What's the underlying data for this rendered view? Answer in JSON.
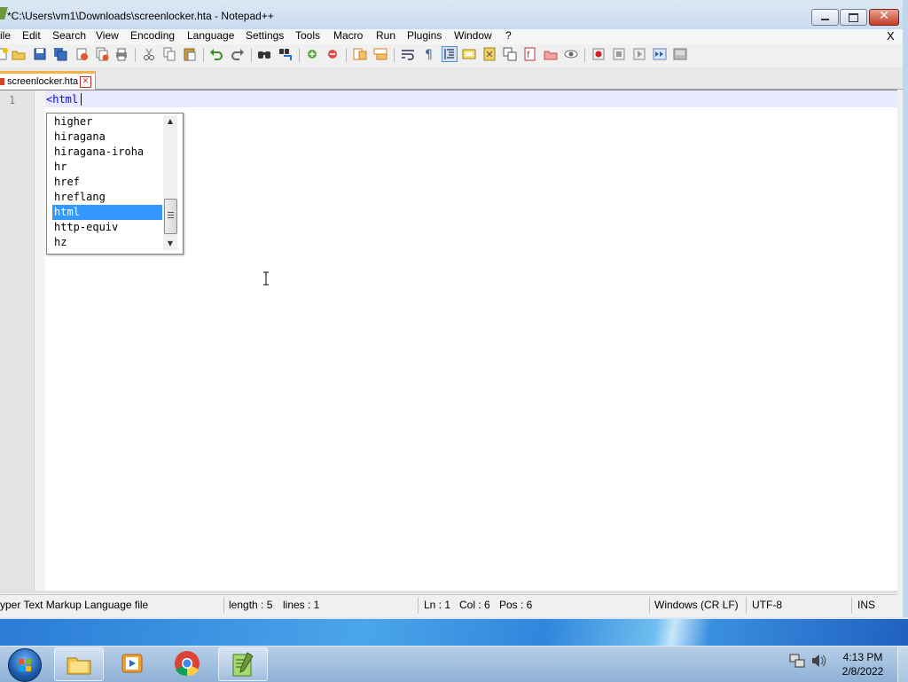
{
  "window": {
    "title": "*C:\\Users\\vm1\\Downloads\\screenlocker.hta - Notepad++"
  },
  "menu": {
    "items": [
      "ile",
      "Edit",
      "Search",
      "View",
      "Encoding",
      "Language",
      "Settings",
      "Tools",
      "Macro",
      "Run",
      "Plugins",
      "Window",
      "?"
    ],
    "close": "X"
  },
  "toolbar": {
    "icons": [
      "new-icon",
      "open-icon",
      "save-icon",
      "save-all-icon",
      "close-icon",
      "close-all-icon",
      "print-icon",
      "cut-icon",
      "copy-icon",
      "paste-icon",
      "undo-icon",
      "redo-icon",
      "find-icon",
      "replace-icon",
      "zoom-in-icon",
      "zoom-out-icon",
      "sync-vertical-icon",
      "sync-horizontal-icon",
      "word-wrap-icon",
      "show-all-chars-icon",
      "indent-guide-icon",
      "user-language-icon",
      "document-map-icon",
      "function-list-icon",
      "folder-as-workspace-icon",
      "monitoring-icon",
      "record-macro-icon",
      "stop-macro-icon",
      "play-macro-icon",
      "run-macro-multiple-icon",
      "save-macro-icon"
    ]
  },
  "tab": {
    "label": "screenlocker.hta",
    "close": "☒"
  },
  "editor": {
    "line_number": "1",
    "code": "<html"
  },
  "autocomplete": {
    "items": [
      "higher",
      "hiragana",
      "hiragana-iroha",
      "hr",
      "href",
      "hreflang",
      "html",
      "http-equiv",
      "hz"
    ],
    "selected": "html"
  },
  "status": {
    "file_type": "yper Text Markup Language file",
    "length": "length : 5",
    "lines": "lines : 1",
    "ln": "Ln : 1",
    "col": "Col : 6",
    "pos": "Pos : 6",
    "eol": "Windows (CR LF)",
    "encoding": "UTF-8",
    "mode": "INS"
  },
  "taskbar": {
    "time": "4:13 PM",
    "date": "2/8/2022",
    "apps": [
      "windows-explorer-icon",
      "media-player-icon",
      "chrome-icon",
      "notepadpp-icon"
    ]
  },
  "colors": {
    "accent": "#3399ff",
    "tab_highlight": "#f7b04a",
    "current_line": "#e8e8ff",
    "tag_blue": "#0000ff"
  }
}
